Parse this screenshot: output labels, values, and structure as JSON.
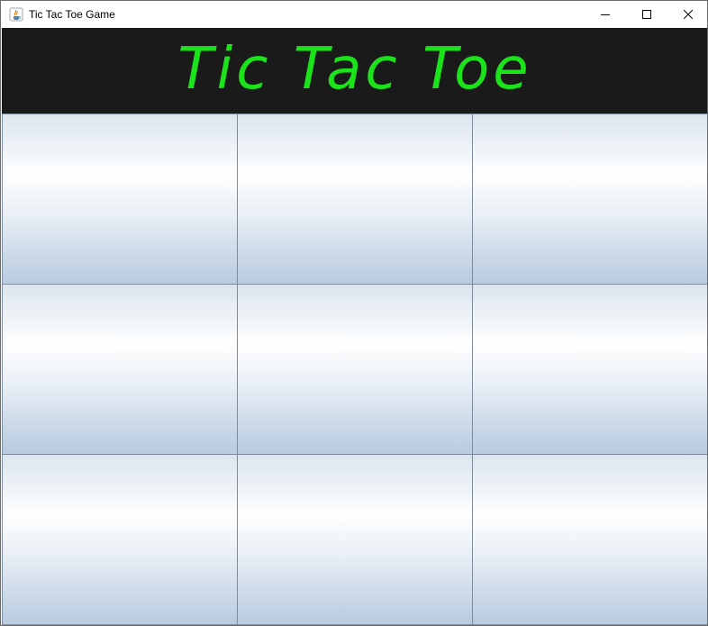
{
  "window": {
    "title": "Tic Tac Toe Game",
    "app_icon": "java-coffee-cup-icon",
    "controls": {
      "minimize_icon": "minimize-icon",
      "maximize_icon": "maximize-icon",
      "close_icon": "close-icon"
    }
  },
  "header": {
    "title": "Tic Tac Toe",
    "background_color": "#1a1a1a",
    "text_color": "#1be21b"
  },
  "board": {
    "cells": [
      "",
      "",
      "",
      "",
      "",
      "",
      "",
      "",
      ""
    ]
  }
}
